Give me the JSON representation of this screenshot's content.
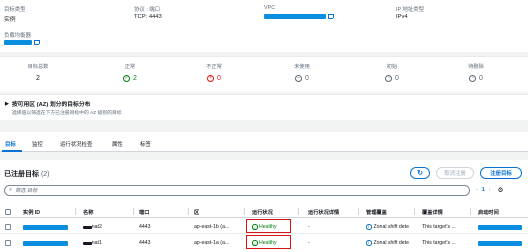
{
  "details": {
    "target_type_label": "目标类型",
    "target_type_value": "实例",
    "protocol_label": "协议 : 端口",
    "protocol_value": "TCP: 4443",
    "vpc_label": "VPC",
    "ip_type_label": "IP 地址类型",
    "ip_type_value": "IPv4",
    "lb_label": "负载均衡器"
  },
  "counts": [
    {
      "label": "目标总数",
      "value": "2",
      "icon": "none"
    },
    {
      "label": "正常",
      "value": "2",
      "icon": "check-circle-icon"
    },
    {
      "label": "不正常",
      "value": "0",
      "icon": "x-circle-icon"
    },
    {
      "label": "未使用",
      "value": "0",
      "icon": "minus-circle-icon"
    },
    {
      "label": "初始",
      "value": "0",
      "icon": "clock-icon"
    },
    {
      "label": "待删除",
      "value": "0",
      "icon": "clock-icon"
    }
  ],
  "az": {
    "title": "按可用区 (AZ) 划分的目标分布",
    "description": "选择值以筛选在下方已注册目标中的 AZ 级别的目标"
  },
  "tabs": [
    "目标",
    "监控",
    "运行状况检查",
    "属性",
    "标签"
  ],
  "registered": {
    "title": "已注册目标",
    "count": "(2)",
    "search_placeholder": "筛选 目标",
    "refresh_icon": "refresh-icon",
    "deregister_label": "取消注册",
    "register_label": "注册目标",
    "page": "1"
  },
  "columns": [
    "实例 ID",
    "名称",
    "端口",
    "区",
    "运行状况",
    "运行状况详情",
    "管理覆盖",
    "覆盖详情",
    "启动时间"
  ],
  "rows": [
    {
      "name": "-nat2",
      "port": "4443",
      "zone": "ap-east-1b (a...",
      "health": "Healthy",
      "details": "-",
      "override": "Zonal shift dete",
      "override_details": "This target's ..."
    },
    {
      "name": "-nat1",
      "port": "4443",
      "zone": "ap-east-1a (a...",
      "health": "Healthy",
      "details": "-",
      "override": "Zonal shift dete",
      "override_details": "This target's ..."
    }
  ],
  "colors": {
    "accent": "#0972d3",
    "healthy": "#037f0c",
    "error": "#d91515",
    "redact": "#0a8ee0"
  }
}
